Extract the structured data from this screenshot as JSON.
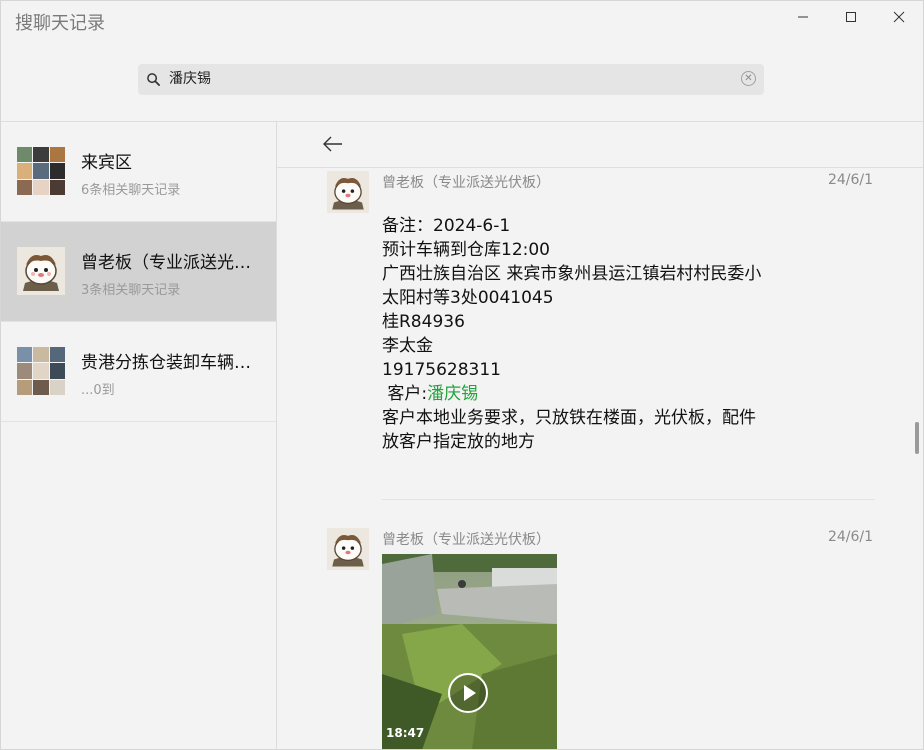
{
  "window": {
    "title": "搜聊天记录",
    "minimize_icon": "minimize-icon",
    "maximize_icon": "maximize-icon",
    "close_icon": "close-icon"
  },
  "search": {
    "value": "潘庆锡",
    "placeholder": "",
    "icon": "search-icon",
    "clear_icon": "clear-icon"
  },
  "sidebar": {
    "items": [
      {
        "name": "来宾区",
        "sub": "6条相关聊天记录",
        "avatar": "group-avatar",
        "active": false
      },
      {
        "name": "曾老板（专业派送光伏板）",
        "sub": "3条相关聊天记录",
        "avatar": "user-avatar",
        "active": true
      },
      {
        "name": "贵港分拣仓装卸车辆调度群",
        "sub": "...0到",
        "avatar": "group-avatar",
        "active": false
      }
    ]
  },
  "content": {
    "back_icon": "back-arrow-icon",
    "messages": [
      {
        "sender": "曾老板（专业派送光伏板）",
        "date": "24/6/1",
        "lines": [
          "备注：2024-6-1",
          "预计车辆到仓库12:00",
          "广西壮族自治区 来宾市象州县运江镇岩村村民委小",
          "太阳村等3处0041045",
          "桂R84936",
          "李太金",
          "19175628311"
        ],
        "customer_prefix": " 客户:",
        "customer_highlight": "潘庆锡",
        "lines_after": [
          "客户本地业务要求，只放铁在楼面，光伏板，配件",
          "放客户指定放的地方"
        ]
      },
      {
        "sender": "曾老板（专业派送光伏板）",
        "date": "24/6/1",
        "video": {
          "duration": "18:47",
          "play_icon": "play-icon"
        }
      }
    ]
  },
  "colors": {
    "highlight": "#20a43a",
    "active_row": "#d2d2d2",
    "background": "#f3f3f3"
  }
}
